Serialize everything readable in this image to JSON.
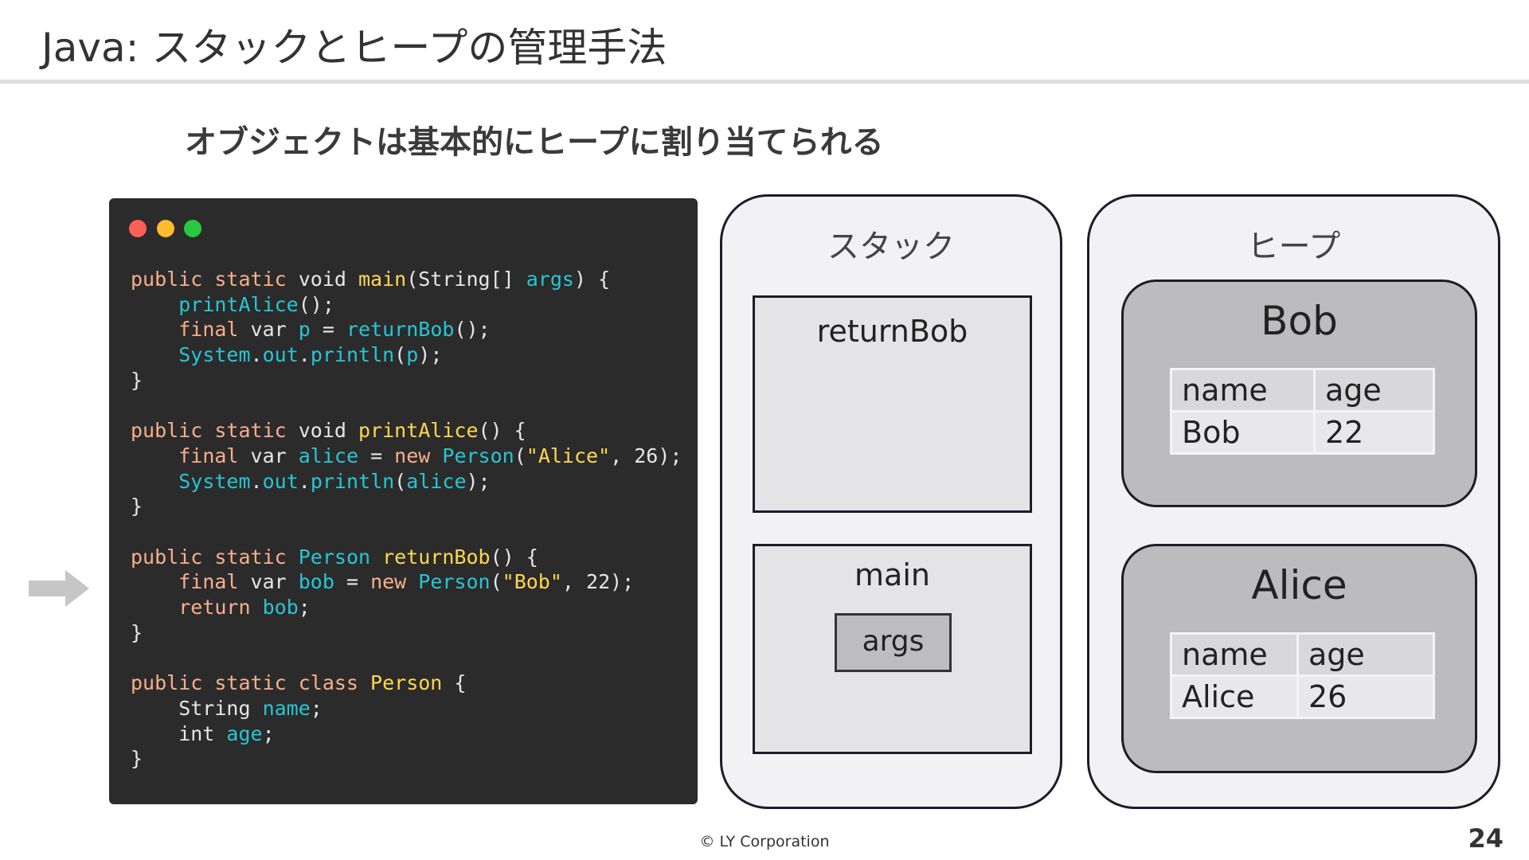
{
  "slide": {
    "title": "Java: スタックとヒープの管理手法",
    "subtitle": "オブジェクトは基本的にヒープに割り当てられる",
    "footer": "© LY Corporation",
    "page_number": "24"
  },
  "code": {
    "lines": [
      "public static void main(String[] args) {",
      "    printAlice();",
      "    final var p = returnBob();",
      "    System.out.println(p);",
      "}",
      "",
      "public static void printAlice() {",
      "    final var alice = new Person(\"Alice\", 26);",
      "    System.out.println(alice);",
      "}",
      "",
      "public static Person returnBob() {",
      "    final var bob = new Person(\"Bob\", 22);",
      "    return bob;",
      "}",
      "",
      "public static class Person {",
      "    String name;",
      "    int age;",
      "}"
    ],
    "current_line_indicator": "arrow-right-icon",
    "colors": {
      "background": "#2b2b2b",
      "keyword": "#f9ae8c",
      "name": "#ffd84d",
      "identifier": "#27c6d4"
    }
  },
  "stack": {
    "title": "スタック",
    "frames": [
      {
        "label": "returnBob",
        "vars": []
      },
      {
        "label": "main",
        "vars": [
          "args"
        ]
      }
    ]
  },
  "heap": {
    "title": "ヒープ",
    "objects": [
      {
        "name": "Bob",
        "headers": [
          "name",
          "age"
        ],
        "values": [
          "Bob",
          "22"
        ]
      },
      {
        "name": "Alice",
        "headers": [
          "name",
          "age"
        ],
        "values": [
          "Alice",
          "26"
        ]
      }
    ]
  }
}
